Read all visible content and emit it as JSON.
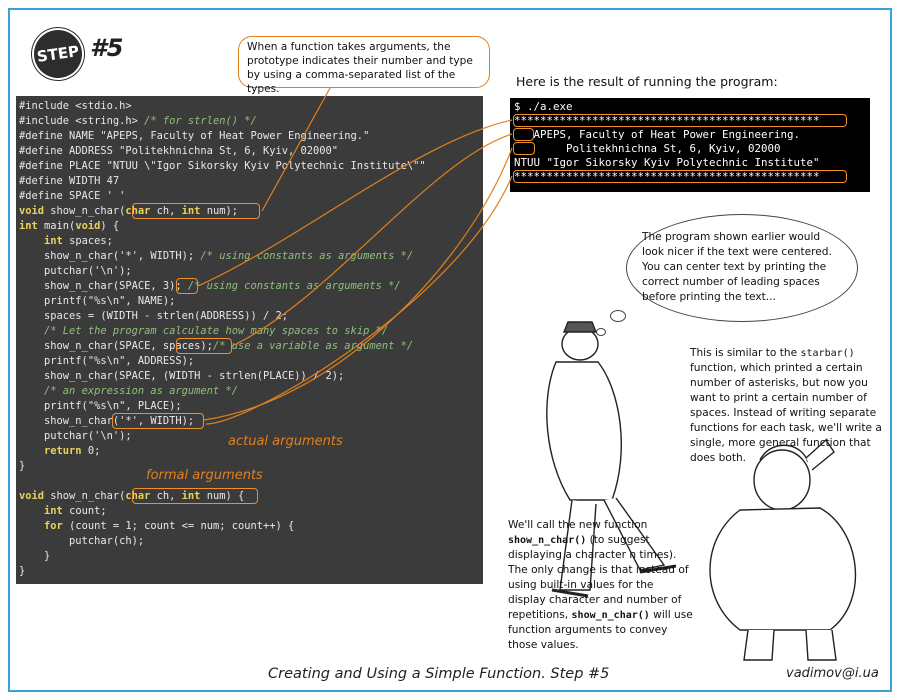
{
  "badge": {
    "label": "STEP",
    "number": "#5"
  },
  "callout_top": "When a function takes arguments, the prototype indicates their number and type by using a comma-separated list of the types.",
  "code_lines": [
    [
      [
        "pp",
        "#include <stdio.h>"
      ]
    ],
    [
      [
        "pp",
        "#include <string.h> "
      ],
      [
        "cm",
        "/* for strlen() */"
      ]
    ],
    [
      [
        "pp",
        "#define NAME \"APEPS, Faculty of Heat Power Engineering.\""
      ]
    ],
    [
      [
        "pp",
        "#define ADDRESS \"Politekhnichna St, 6, Kyiv, 02000\""
      ]
    ],
    [
      [
        "pp",
        "#define PLACE \"NTUU \\\"Igor Sikorsky Kyiv Polytechnic Institute\\\"\""
      ]
    ],
    [
      [
        "pp",
        "#define WIDTH 47"
      ]
    ],
    [
      [
        "pp",
        "#define SPACE ' '"
      ]
    ],
    [
      [
        "kw",
        "void"
      ],
      [
        "tx",
        " show_n_char("
      ],
      [
        "kw",
        "char"
      ],
      [
        "tx",
        " ch, "
      ],
      [
        "kw",
        "int"
      ],
      [
        "tx",
        " num);"
      ]
    ],
    [
      [
        "kw",
        "int"
      ],
      [
        "tx",
        " main("
      ],
      [
        "kw",
        "void"
      ],
      [
        "tx",
        ") {"
      ]
    ],
    [
      [
        "tx",
        "    "
      ],
      [
        "kw",
        "int"
      ],
      [
        "tx",
        " spaces;"
      ]
    ],
    [
      [
        "tx",
        "    show_n_char('*', WIDTH); "
      ],
      [
        "cm",
        "/* using constants as arguments */"
      ]
    ],
    [
      [
        "tx",
        "    putchar('\\n');"
      ]
    ],
    [
      [
        "tx",
        "    show_n_char(SPACE, 3); "
      ],
      [
        "cm",
        "/* using constants as arguments */"
      ]
    ],
    [
      [
        "tx",
        "    printf(\"%s\\n\", NAME);"
      ]
    ],
    [
      [
        "tx",
        "    spaces = (WIDTH - strlen(ADDRESS)) / 2;"
      ]
    ],
    [
      [
        "tx",
        "    "
      ],
      [
        "cm",
        "/* Let the program calculate how many spaces to skip */"
      ]
    ],
    [
      [
        "tx",
        "    show_n_char(SPACE, spaces);"
      ],
      [
        "cm",
        "/* use a variable as argument */"
      ]
    ],
    [
      [
        "tx",
        "    printf(\"%s\\n\", ADDRESS);"
      ]
    ],
    [
      [
        "tx",
        "    show_n_char(SPACE, (WIDTH - strlen(PLACE)) / 2);"
      ]
    ],
    [
      [
        "tx",
        "    "
      ],
      [
        "cm",
        "/* an expression as argument */"
      ]
    ],
    [
      [
        "tx",
        "    printf(\"%s\\n\", PLACE);"
      ]
    ],
    [
      [
        "tx",
        "    show_n_char('*', WIDTH);"
      ]
    ],
    [
      [
        "tx",
        "    putchar('\\n');"
      ]
    ],
    [
      [
        "tx",
        "    "
      ],
      [
        "kw",
        "return"
      ],
      [
        "tx",
        " 0;"
      ]
    ],
    [
      [
        "tx",
        "}"
      ]
    ],
    [
      [
        "tx",
        ""
      ]
    ],
    [
      [
        "kw",
        "void"
      ],
      [
        "tx",
        " show_n_char("
      ],
      [
        "kw",
        "char"
      ],
      [
        "tx",
        " ch, "
      ],
      [
        "kw",
        "int"
      ],
      [
        "tx",
        " num) {"
      ]
    ],
    [
      [
        "tx",
        "    "
      ],
      [
        "kw",
        "int"
      ],
      [
        "tx",
        " count;"
      ]
    ],
    [
      [
        "tx",
        "    "
      ],
      [
        "kw",
        "for"
      ],
      [
        "tx",
        " (count = 1; count <= num; count++) {"
      ]
    ],
    [
      [
        "tx",
        "        putchar(ch);"
      ]
    ],
    [
      [
        "tx",
        "    }"
      ]
    ],
    [
      [
        "tx",
        "}"
      ]
    ]
  ],
  "labels": {
    "actual": "actual arguments",
    "formal": "formal arguments"
  },
  "result_title": "Here is the result of running the program:",
  "console_lines": [
    "$ ./a.exe",
    "***********************************************",
    "   APEPS, Faculty of Heat Power Engineering.",
    "        Politekhnichna St, 6, Kyiv, 02000",
    "NTUU \"Igor Sikorsky Kyiv Polytechnic Institute\"",
    "***********************************************"
  ],
  "thought_text": "The program shown earlier would look nicer if the text were centered. You can center text by printing the correct number of leading spaces before printing the text...",
  "para_right": {
    "p1": "This is similar to the ",
    "code": "starbar()",
    "p2": " function, which printed a certain number of asterisks, but now you want to print a certain number of spaces. Instead of writing separate functions for each task, we'll write a single, more general function that does both."
  },
  "para_left": {
    "p1": "We'll call the new function ",
    "code1": "show_n_char()",
    "p2": " (to suggest displaying a character n times). The only change is that instead of using built-in values for the display character and number of repetitions, ",
    "code2": "show_n_char()",
    "p3": " will use function arguments to convey those values."
  },
  "footer": {
    "title": "Creating and Using a Simple Function. Step #5",
    "email": "vadimov@i.ua"
  },
  "colors": {
    "accent_orange": "#e0801e",
    "frame_blue": "#3aa0d8",
    "code_bg": "#3b3b3b"
  }
}
